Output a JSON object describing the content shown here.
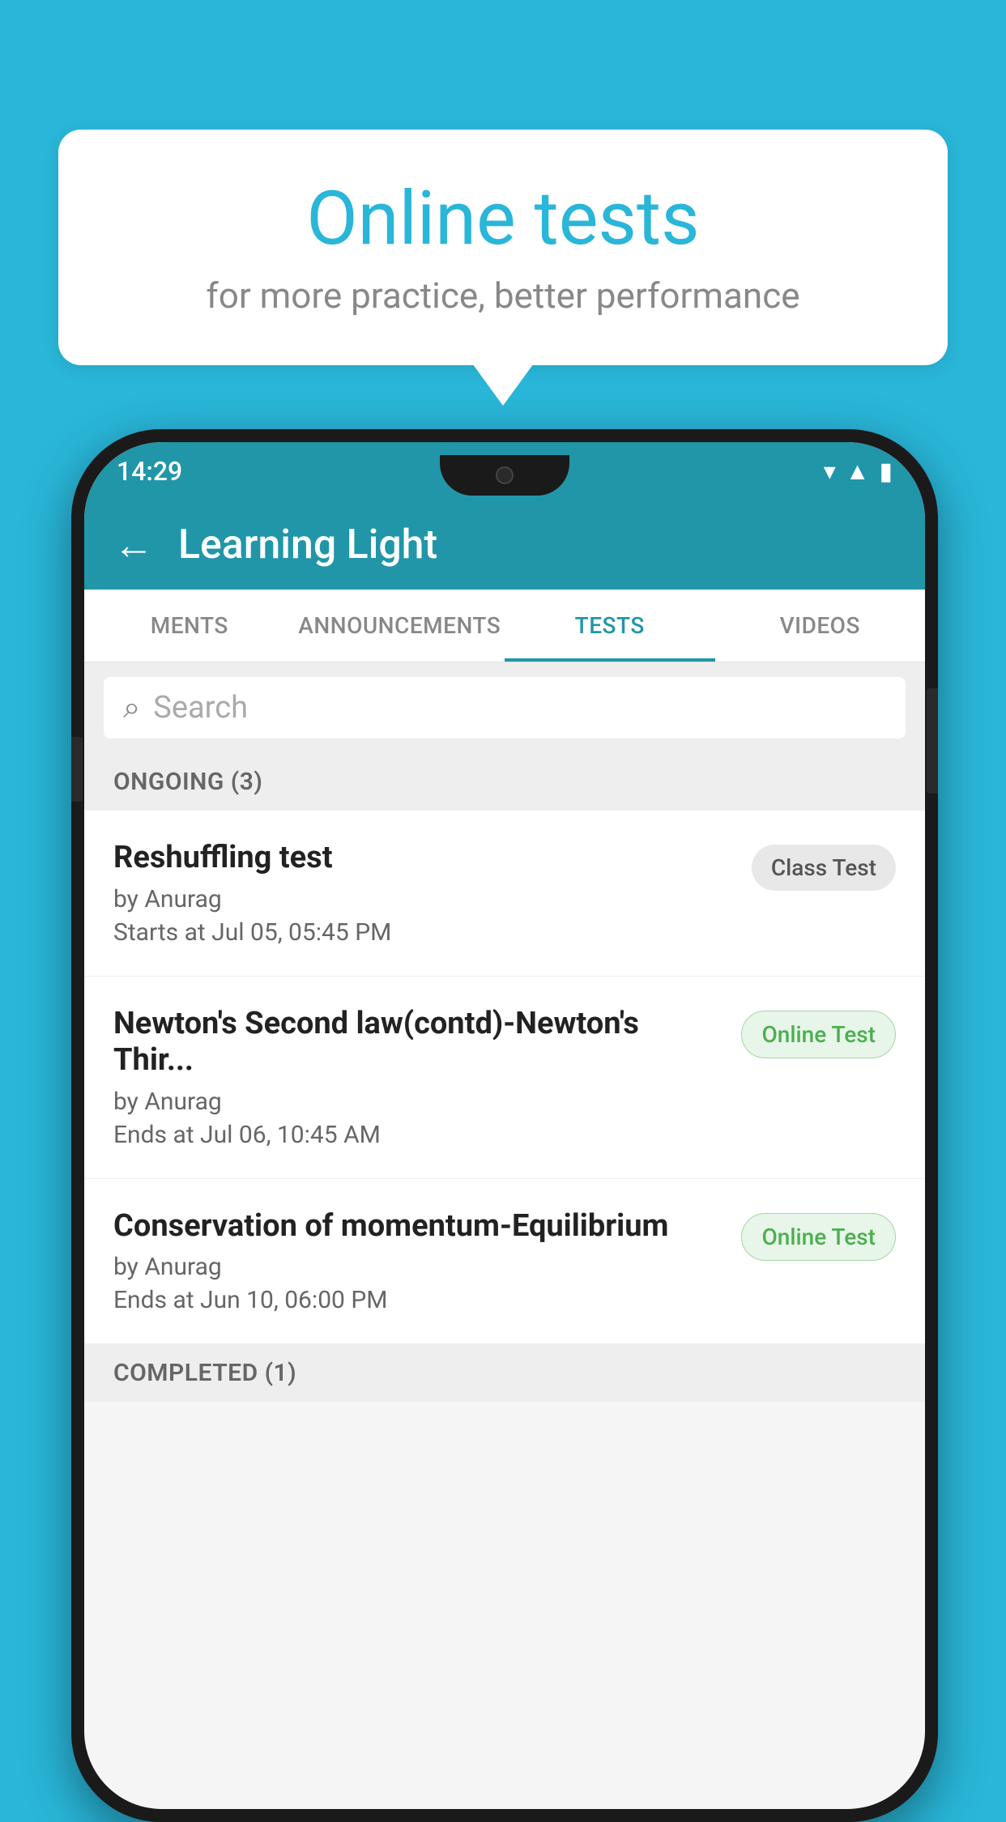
{
  "background_color": "#29b6d8",
  "bubble": {
    "title": "Online tests",
    "subtitle": "for more practice, better performance"
  },
  "phone": {
    "status_bar": {
      "time": "14:29",
      "icons": [
        "wifi",
        "signal",
        "battery"
      ]
    },
    "app_bar": {
      "title": "Learning Light",
      "back_label": "←"
    },
    "tabs": [
      {
        "label": "MENTS",
        "active": false
      },
      {
        "label": "ANNOUNCEMENTS",
        "active": false
      },
      {
        "label": "TESTS",
        "active": true
      },
      {
        "label": "VIDEOS",
        "active": false
      }
    ],
    "search": {
      "placeholder": "Search"
    },
    "sections": [
      {
        "header": "ONGOING (3)",
        "tests": [
          {
            "name": "Reshuffling test",
            "by": "by Anurag",
            "date": "Starts at  Jul 05, 05:45 PM",
            "badge": "Class Test",
            "badge_type": "class"
          },
          {
            "name": "Newton's Second law(contd)-Newton's Thir...",
            "by": "by Anurag",
            "date": "Ends at  Jul 06, 10:45 AM",
            "badge": "Online Test",
            "badge_type": "online"
          },
          {
            "name": "Conservation of momentum-Equilibrium",
            "by": "by Anurag",
            "date": "Ends at  Jun 10, 06:00 PM",
            "badge": "Online Test",
            "badge_type": "online"
          }
        ]
      }
    ],
    "completed_section": "COMPLETED (1)"
  }
}
